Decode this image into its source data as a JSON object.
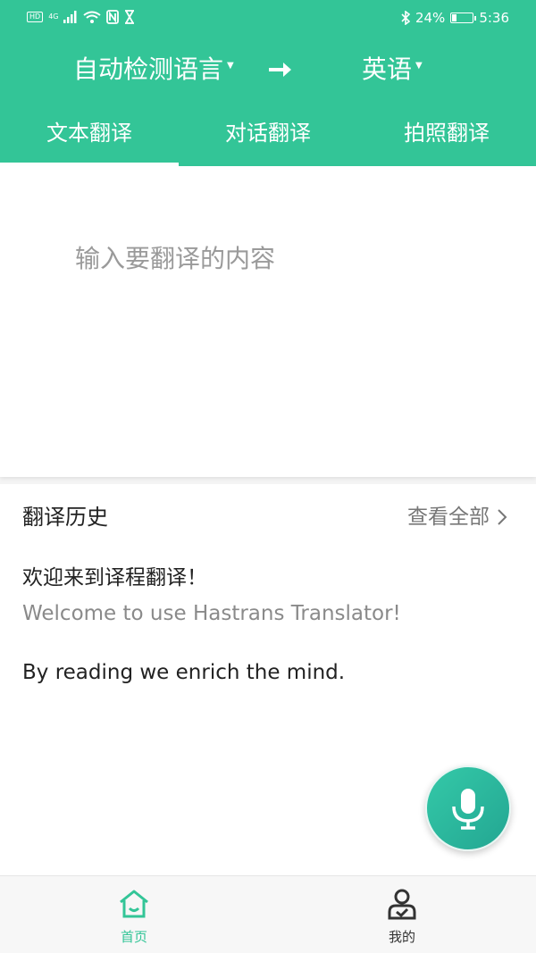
{
  "status_bar": {
    "hd": "HD",
    "network": "4G",
    "battery_text": "24%",
    "battery_level": 0.24,
    "time": "5:36"
  },
  "header": {
    "source_language": "自动检测语言",
    "target_language": "英语",
    "tabs": [
      {
        "label": "文本翻译",
        "active": true
      },
      {
        "label": "对话翻译",
        "active": false
      },
      {
        "label": "拍照翻译",
        "active": false
      }
    ]
  },
  "input": {
    "placeholder": "输入要翻译的内容",
    "value": ""
  },
  "history": {
    "title": "翻译历史",
    "view_all": "查看全部",
    "entries": [
      {
        "source": "欢迎来到译程翻译！",
        "translation": "Welcome to use Hastrans Translator!"
      },
      {
        "source": "By reading we enrich the mind.",
        "translation": ""
      }
    ]
  },
  "bottom_nav": {
    "items": [
      {
        "label": "首页",
        "active": true
      },
      {
        "label": "我的",
        "active": false
      }
    ]
  },
  "colors": {
    "brand": "#33c597",
    "fab": "#2ab8a0"
  }
}
